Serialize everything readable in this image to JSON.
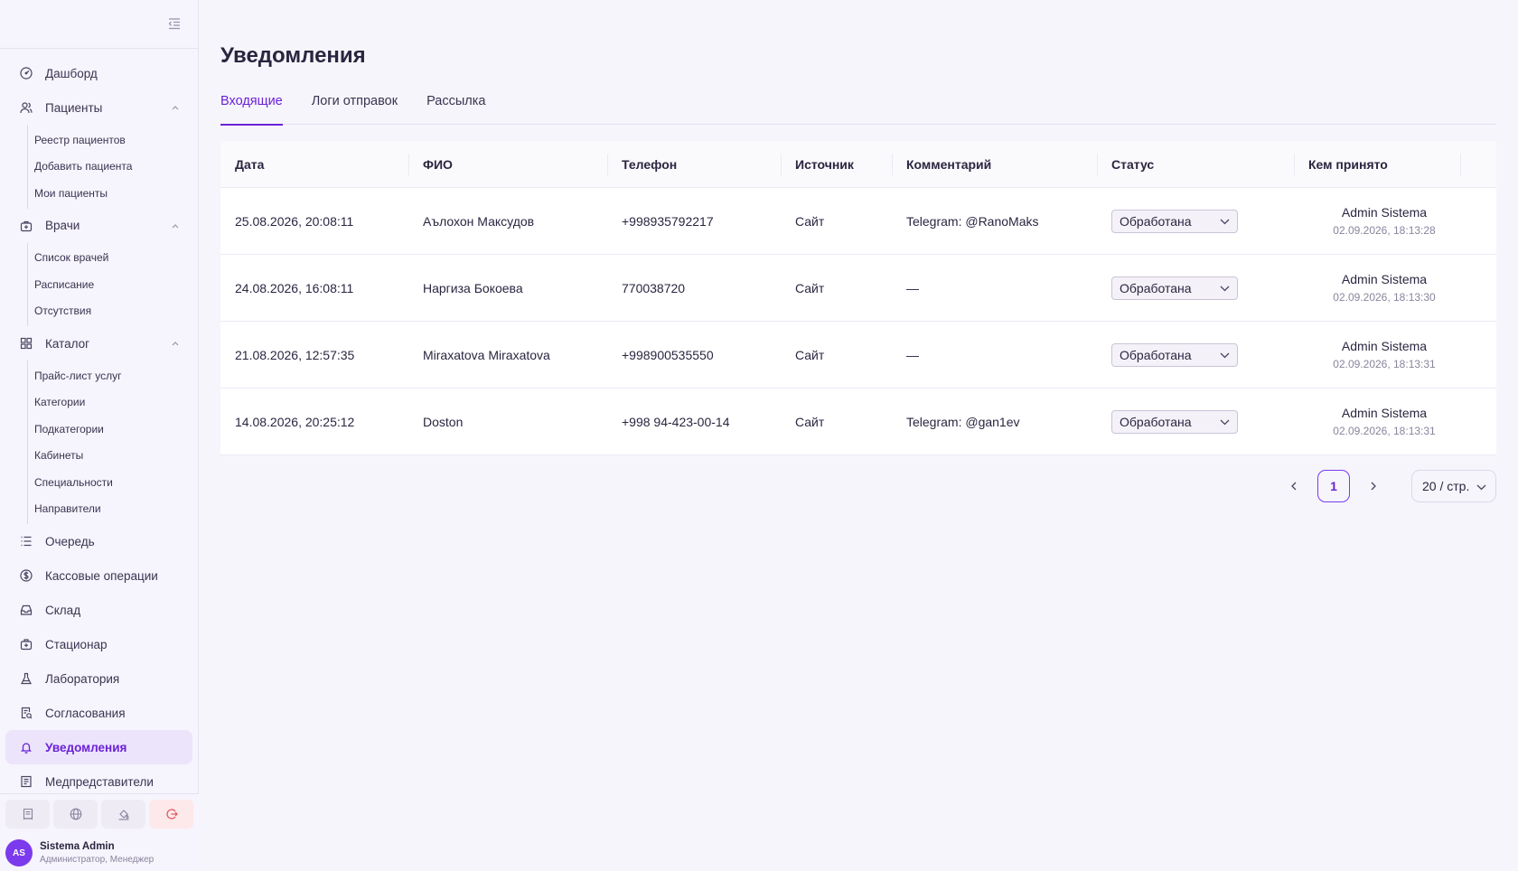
{
  "sidebar": {
    "items": [
      {
        "label": "Дашборд",
        "icon": "dashboard-icon"
      },
      {
        "label": "Пациенты",
        "icon": "users-icon",
        "expanded": true,
        "children": [
          "Реестр пациентов",
          "Добавить пациента",
          "Мои пациенты"
        ]
      },
      {
        "label": "Врачи",
        "icon": "medical-bag-icon",
        "expanded": true,
        "children": [
          "Список врачей",
          "Расписание",
          "Отсутствия"
        ]
      },
      {
        "label": "Каталог",
        "icon": "grid-icon",
        "expanded": true,
        "children": [
          "Прайс-лист услуг",
          "Категории",
          "Подкатегории",
          "Кабинеты",
          "Специальности",
          "Направители"
        ]
      },
      {
        "label": "Очередь",
        "icon": "list-icon"
      },
      {
        "label": "Кассовые операции",
        "icon": "dollar-icon"
      },
      {
        "label": "Склад",
        "icon": "inbox-icon"
      },
      {
        "label": "Стационар",
        "icon": "hospital-icon"
      },
      {
        "label": "Лаборатория",
        "icon": "flask-icon"
      },
      {
        "label": "Согласования",
        "icon": "document-check-icon"
      },
      {
        "label": "Уведомления",
        "icon": "bell-icon",
        "active": true
      },
      {
        "label": "Медпредставители",
        "icon": "clipboard-icon"
      }
    ],
    "user": {
      "initials": "AS",
      "name": "Sistema Admin",
      "role": "Администратор, Менеджер"
    }
  },
  "page": {
    "title": "Уведомления"
  },
  "tabs": [
    {
      "label": "Входящие",
      "active": true
    },
    {
      "label": "Логи отправок"
    },
    {
      "label": "Рассылка"
    }
  ],
  "table": {
    "columns": [
      "Дата",
      "ФИО",
      "Телефон",
      "Источник",
      "Комментарий",
      "Статус",
      "Кем принято"
    ],
    "rows": [
      {
        "date": "25.08.2026, 20:08:11",
        "name": "Аълохон Максудов",
        "phone": "+998935792217",
        "source": "Сайт",
        "comment": "Telegram: @RanoMaks",
        "status": "Обработана",
        "accepted_by": "Admin Sistema",
        "accepted_at": "02.09.2026, 18:13:28"
      },
      {
        "date": "24.08.2026, 16:08:11",
        "name": "Наргиза Бокоева",
        "phone": "770038720",
        "source": "Сайт",
        "comment": "—",
        "status": "Обработана",
        "accepted_by": "Admin Sistema",
        "accepted_at": "02.09.2026, 18:13:30"
      },
      {
        "date": "21.08.2026, 12:57:35",
        "name": "Miraxatova Miraxatova",
        "phone": "+998900535550",
        "source": "Сайт",
        "comment": "—",
        "status": "Обработана",
        "accepted_by": "Admin Sistema",
        "accepted_at": "02.09.2026, 18:13:31"
      },
      {
        "date": "14.08.2026, 20:25:12",
        "name": "Doston",
        "phone": "+998 94-423-00-14",
        "source": "Сайт",
        "comment": "Telegram: @gan1ev",
        "status": "Обработана",
        "accepted_by": "Admin Sistema",
        "accepted_at": "02.09.2026, 18:13:31"
      }
    ]
  },
  "pagination": {
    "current_page": "1",
    "page_size": "20 / стр."
  },
  "colors": {
    "accent": "#6b21d8",
    "avatar": "#7c3aed",
    "active_bg": "#ece4fb"
  }
}
